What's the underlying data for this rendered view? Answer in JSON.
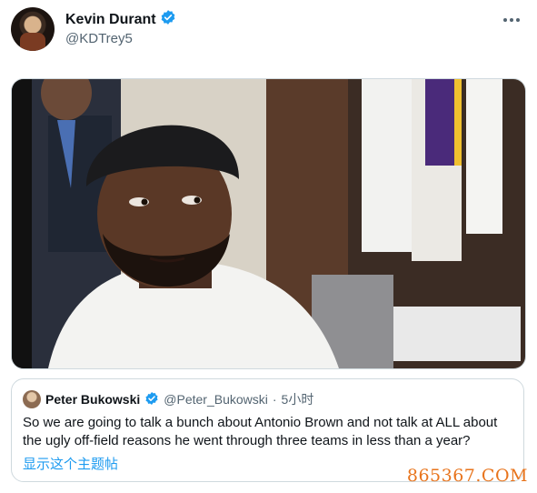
{
  "tweet": {
    "author": {
      "name": "Kevin Durant",
      "handle": "@KDTrey5"
    },
    "verified_color": "#1d9bf0"
  },
  "quote": {
    "author": {
      "name": "Peter Bukowski",
      "handle": "@Peter_Bukowski"
    },
    "separator": "·",
    "time": "5小时",
    "text": "So we are going to talk a bunch about Antonio Brown and not talk at ALL about the ugly off-field reasons he went through three teams in less than a year?",
    "show_thread": "显示这个主题帖"
  },
  "watermark": "865367.COM"
}
